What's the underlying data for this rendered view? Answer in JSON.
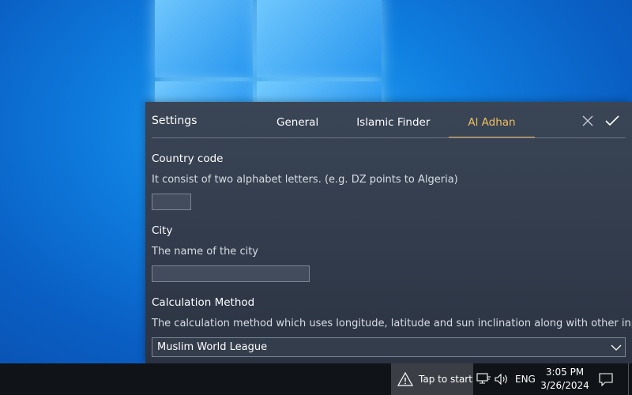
{
  "settings": {
    "title": "Settings",
    "tabs": [
      {
        "label": "General"
      },
      {
        "label": "Islamic Finder"
      },
      {
        "label": "Al Adhan"
      }
    ],
    "active_tab": "Al Adhan",
    "country_code": {
      "label": "Country code",
      "description": "It consist of two alphabet letters. (e.g. DZ points to Algeria)",
      "value": ""
    },
    "city": {
      "label": "City",
      "description": "The name of the city",
      "value": ""
    },
    "calculation_method": {
      "label": "Calculation Method",
      "description": "The calculation method which uses longitude, latitude and sun inclination along with other inputs",
      "selected": "Muslim World League"
    },
    "icons": {
      "close": "close-icon",
      "accept": "checkmark-icon",
      "dropdown": "chevron-down-icon"
    }
  },
  "taskbar": {
    "tap_to_start": "Tap to start",
    "language": "ENG",
    "time": "3:05 PM",
    "date": "3/26/2024",
    "icons": [
      "warning-icon",
      "network-icon",
      "volume-icon",
      "notification-icon"
    ]
  },
  "colors": {
    "accent": "#e0b060",
    "panel_bg": "#343d4c",
    "taskbar_bg": "#101418",
    "wallpaper": "#0a64c8"
  }
}
